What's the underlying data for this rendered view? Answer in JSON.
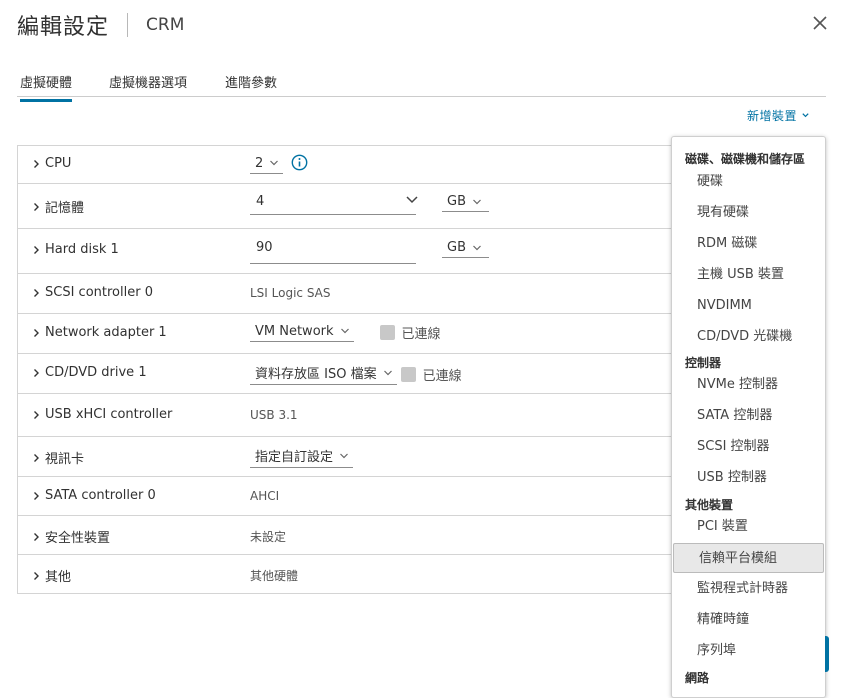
{
  "header": {
    "title": "編輯設定",
    "subtitle": "CRM"
  },
  "tabs": [
    {
      "label": "虛擬硬體",
      "active": true
    },
    {
      "label": "虛擬機器選項",
      "active": false
    },
    {
      "label": "進階參數",
      "active": false
    }
  ],
  "add_device": {
    "label": "新增裝置"
  },
  "hardware": {
    "cpu": {
      "label": "CPU",
      "value": "2"
    },
    "memory": {
      "label": "記憶體",
      "value": "4",
      "unit": "GB"
    },
    "hard_disk": {
      "label": "Hard disk 1",
      "value": "90",
      "unit": "GB"
    },
    "scsi": {
      "label": "SCSI controller 0",
      "value": "LSI Logic SAS"
    },
    "network": {
      "label": "Network adapter 1",
      "value": "VM Network",
      "connected_label": "已連線"
    },
    "cddvd": {
      "label": "CD/DVD drive 1",
      "value": "資料存放區 ISO 檔案",
      "connected_label": "已連線"
    },
    "usb": {
      "label": "USB xHCI controller",
      "value": "USB 3.1"
    },
    "video": {
      "label": "視訊卡",
      "value": "指定自訂設定"
    },
    "sata": {
      "label": "SATA controller 0",
      "value": "AHCI"
    },
    "security": {
      "label": "安全性裝置",
      "value": "未設定"
    },
    "other": {
      "label": "其他",
      "value": "其他硬體"
    }
  },
  "dropdown": {
    "groups": [
      {
        "label": "磁碟、磁碟機和儲存區",
        "items": [
          "硬碟",
          "現有硬碟",
          "RDM 磁碟",
          "主機 USB 裝置",
          "NVDIMM",
          "CD/DVD 光碟機"
        ]
      },
      {
        "label": "控制器",
        "items": [
          "NVMe 控制器",
          "SATA 控制器",
          "SCSI 控制器",
          "USB 控制器"
        ]
      },
      {
        "label": "其他裝置",
        "items": [
          "PCI 裝置",
          "信賴平台模組",
          "監視程式計時器",
          "精確時鐘",
          "序列埠"
        ]
      },
      {
        "label": "網路",
        "items": []
      }
    ],
    "highlighted": "信賴平台模組"
  },
  "colors": {
    "accent": "#0072a3",
    "border": "#d4d4d4",
    "highlight": "#e8e8e8"
  }
}
